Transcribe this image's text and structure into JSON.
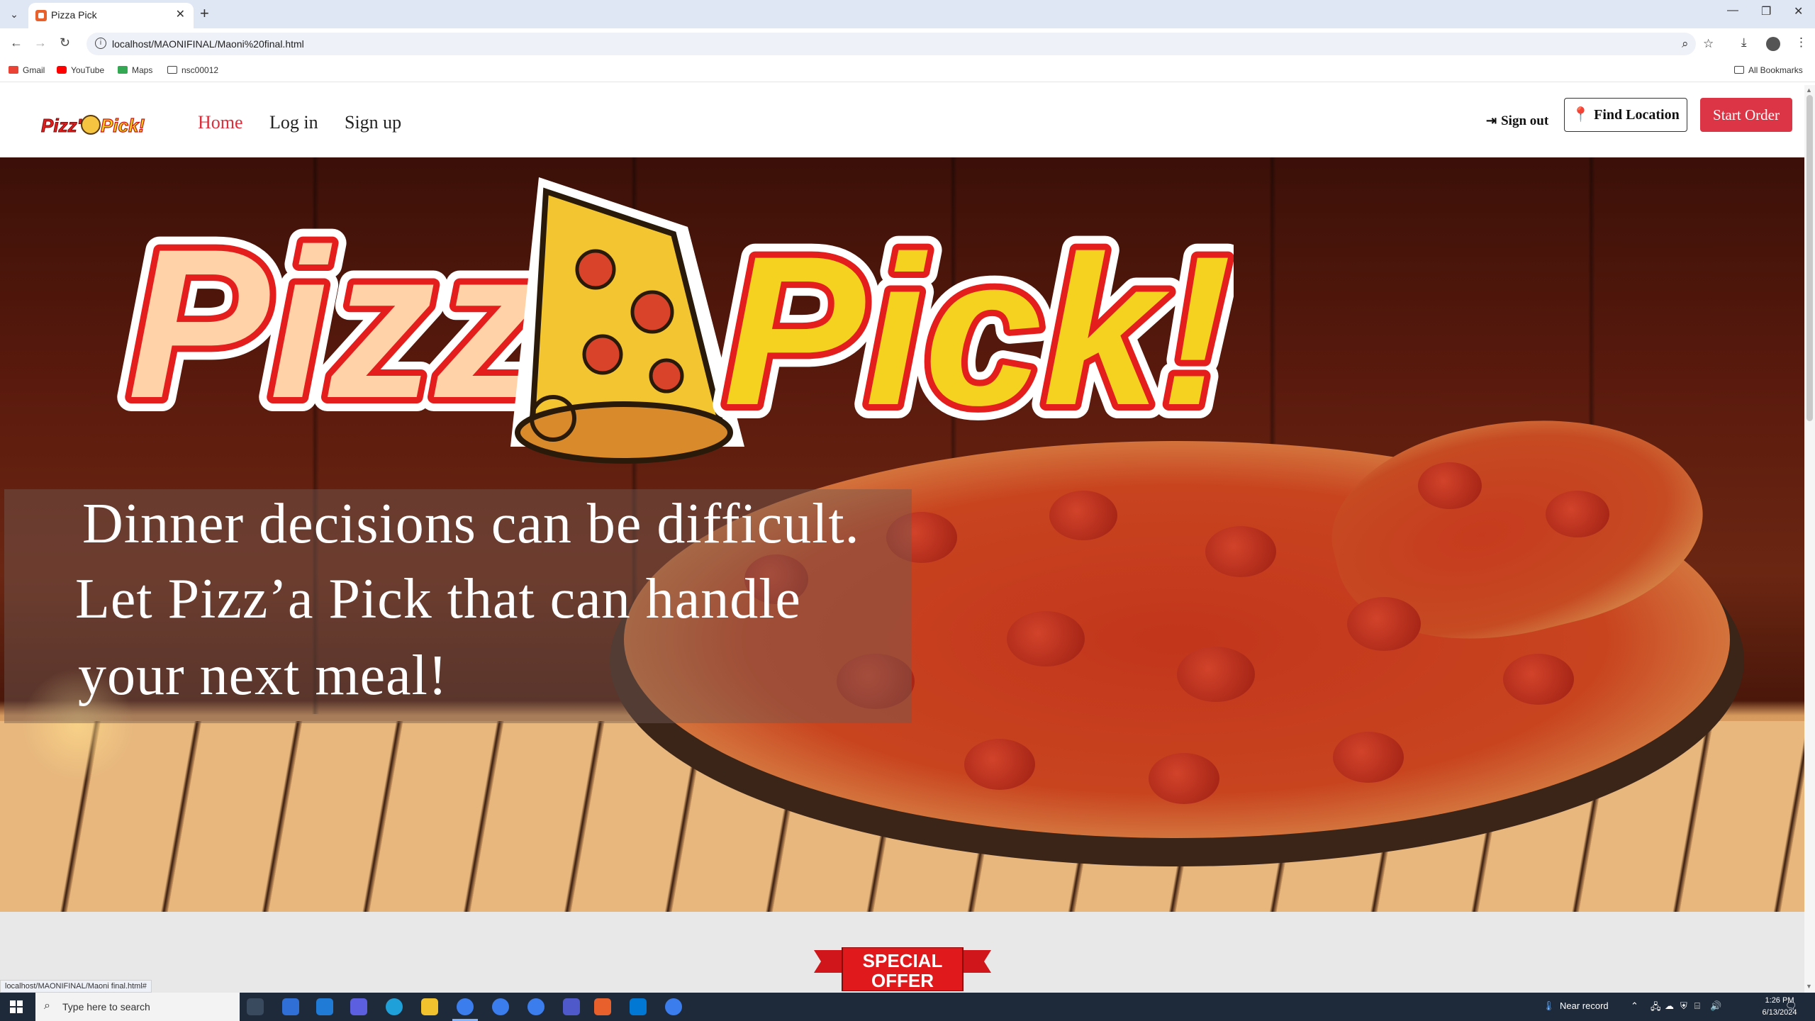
{
  "browser": {
    "tab_title": "Pizza Pick",
    "url": "localhost/MAONIFINAL/Maoni%20final.html",
    "bookmarks": [
      "Gmail",
      "YouTube",
      "Maps",
      "nsc00012"
    ],
    "all_bookmarks": "All Bookmarks",
    "status_url": "localhost/MAONIFINAL/Maoni final.html#"
  },
  "nav": {
    "home": "Home",
    "login": "Log in",
    "signup": "Sign up",
    "signout": "Sign out",
    "find_location": "Find Location",
    "start_order": "Start Order"
  },
  "hero": {
    "logo_text_left": "Pizz'",
    "logo_text_right": "Pick!",
    "line1": "Dinner decisions can be difficult.",
    "line2": "Let Pizz’a Pick that can handle",
    "line3": "your next meal!"
  },
  "offer": {
    "ribbon_line1": "SPECIAL",
    "ribbon_line2": "OFFER"
  },
  "taskbar": {
    "search_placeholder": "Type here to search",
    "weather": "Near record",
    "time": "1:26 PM",
    "date": "6/13/2024"
  },
  "colors": {
    "accent_red": "#dc3545",
    "nav_active": "#dc2e3a",
    "logo_yellow": "#f5d21f",
    "logo_red": "#e41d1d",
    "logo_peach": "#ffd2a8"
  }
}
